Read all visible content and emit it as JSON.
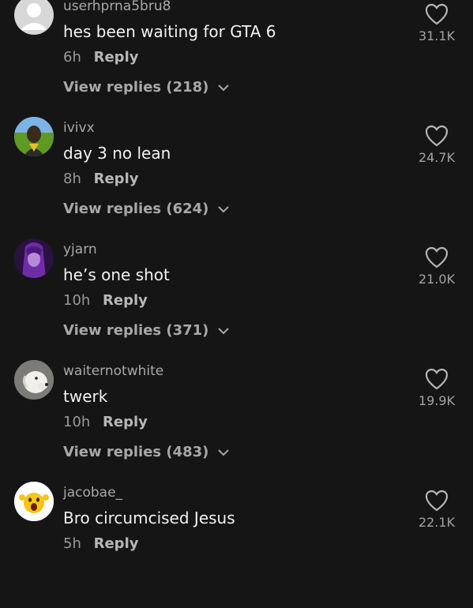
{
  "comments": [
    {
      "username": "userhprna5bru8",
      "text": "hes been waiting for GTA 6",
      "time": "6h",
      "reply_label": "Reply",
      "view_replies": "View replies (218)",
      "likes": "31.1K",
      "avatar": "default-avatar-icon"
    },
    {
      "username": "ivivx",
      "text": "day 3 no lean",
      "time": "8h",
      "reply_label": "Reply",
      "view_replies": "View replies (624)",
      "likes": "24.7K",
      "avatar": "person-avatar"
    },
    {
      "username": "yjarn",
      "text": "he’s one shot",
      "time": "10h",
      "reply_label": "Reply",
      "view_replies": "View replies (371)",
      "likes": "21.0K",
      "avatar": "purple-character-avatar"
    },
    {
      "username": "waiternotwhite",
      "text": "twerk",
      "time": "10h",
      "reply_label": "Reply",
      "view_replies": "View replies (483)",
      "likes": "19.9K",
      "avatar": "dog-avatar"
    },
    {
      "username": "jacobae_",
      "text": "Bro circumcised Jesus",
      "time": "5h",
      "reply_label": "Reply",
      "view_replies": "",
      "likes": "22.1K",
      "avatar": "screaming-emoji-avatar"
    }
  ],
  "colors": {
    "background": "#151515",
    "text": "#f2f2f2",
    "muted": "#a9a9a9"
  }
}
